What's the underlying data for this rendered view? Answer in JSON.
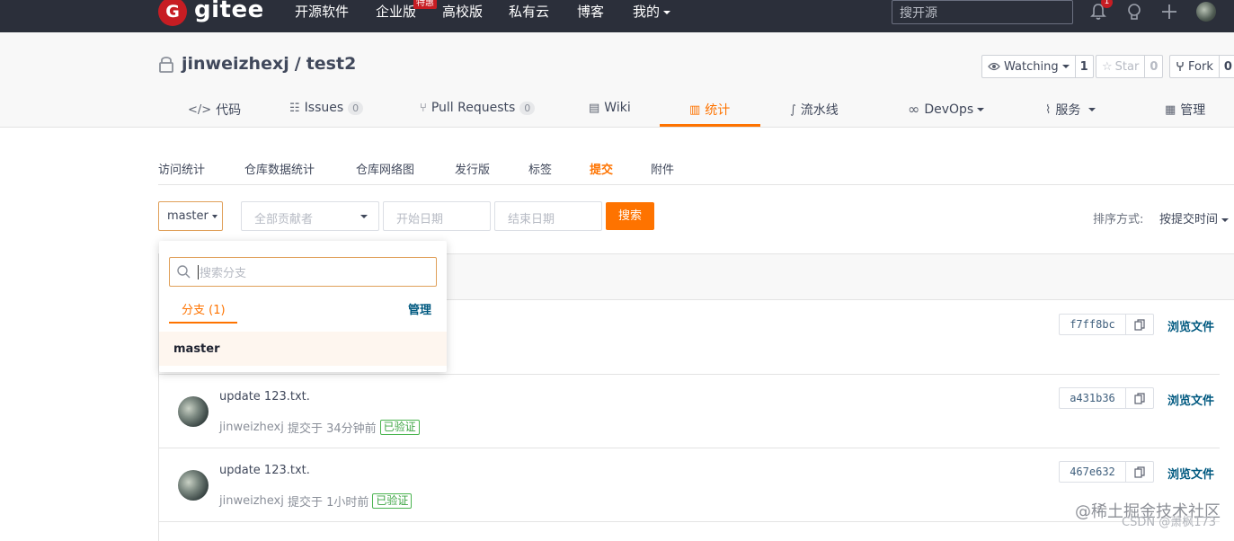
{
  "topnav": {
    "logo_letter": "G",
    "logo_text": "gitee",
    "items": [
      "开源软件",
      "企业版",
      "高校版",
      "私有云",
      "博客",
      "我的"
    ],
    "enterprise_badge": "特惠",
    "search_placeholder": "搜开源",
    "notification_count": "1",
    "icons": [
      "bell-icon",
      "lightbulb-icon",
      "plus-icon",
      "avatar"
    ]
  },
  "repo": {
    "owner": "jinweizhexj",
    "separator": "/",
    "name": "test2",
    "watch_label": "Watching",
    "watch_count": "1",
    "star_label": "Star",
    "star_count": "0",
    "fork_label": "Fork",
    "fork_count": "0"
  },
  "tabs": [
    {
      "icon": "code-icon",
      "label": "代码"
    },
    {
      "icon": "issues-icon",
      "label": "Issues",
      "count": "0"
    },
    {
      "icon": "pull-request-icon",
      "label": "Pull Requests",
      "count": "0"
    },
    {
      "icon": "wiki-icon",
      "label": "Wiki"
    },
    {
      "icon": "chart-icon",
      "label": "统计"
    },
    {
      "icon": "pipeline-icon",
      "label": "流水线"
    },
    {
      "icon": "devops-icon",
      "label": "DevOps"
    },
    {
      "icon": "pulse-icon",
      "label": "服务"
    },
    {
      "icon": "manage-icon",
      "label": "管理"
    }
  ],
  "active_tab": "统计",
  "subtabs": [
    "访问统计",
    "仓库数据统计",
    "仓库网络图",
    "发行版",
    "标签",
    "提交",
    "附件"
  ],
  "active_subtab": "提交",
  "filters": {
    "branch": "master",
    "contributor_placeholder": "全部贡献者",
    "start_placeholder": "开始日期",
    "end_placeholder": "结束日期",
    "search_button": "搜索",
    "sort_label": "排序方式:",
    "sort_value": "按提交时间"
  },
  "dropdown": {
    "search_placeholder": "搜索分支",
    "tab_label": "分支 (1)",
    "manage_label": "管理",
    "items": [
      "master"
    ]
  },
  "commits": [
    {
      "message": "",
      "author": "",
      "time": "",
      "verified": "",
      "sha": "f7ff8bc",
      "browse": "浏览文件"
    },
    {
      "message": "update 123.txt.",
      "author": "jinweizhexj",
      "time": "提交于 34分钟前",
      "verified": "已验证",
      "sha": "a431b36",
      "browse": "浏览文件"
    },
    {
      "message": "update 123.txt.",
      "author": "jinweizhexj",
      "time": "提交于 1小时前",
      "verified": "已验证",
      "sha": "467e632",
      "browse": "浏览文件"
    }
  ],
  "watermark": {
    "line1": "@稀土掘金技术社区",
    "line2": "CSDN @萧枫173"
  },
  "colors": {
    "accent": "#fe7300",
    "nav_bg": "#2b2f3a",
    "brand_red": "#c71d23",
    "verified_green": "#3ea544"
  }
}
